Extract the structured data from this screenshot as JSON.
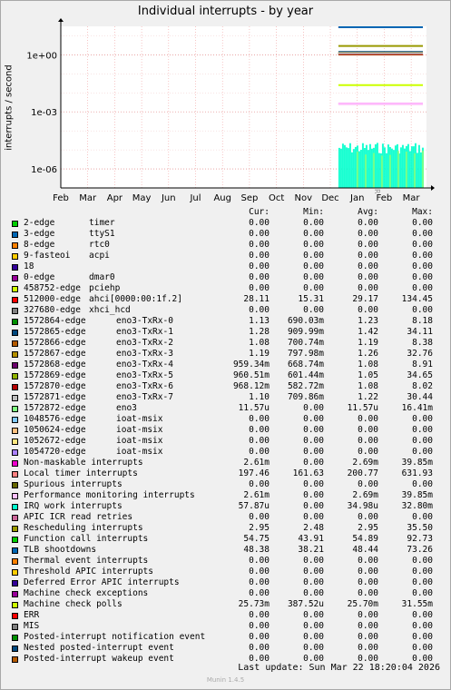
{
  "title": "Individual interrupts - by year",
  "ylabel": "interrupts / second",
  "watermark": "RRDTOOL / TOBI OETIKER",
  "footer": {
    "last_update": "Last update:  Sun Mar 22 18:20:04 2026",
    "version": "Munin 1.4.5"
  },
  "table_headers": {
    "cur": "Cur:",
    "min": "Min:",
    "avg": "Avg:",
    "max": "Max:"
  },
  "chart_data": {
    "type": "line",
    "title": "Individual interrupts - by year",
    "ylabel": "interrupts / second",
    "xlabel": "",
    "y_scale": "log",
    "y_ticks": [
      "1e-06",
      "1e-03",
      "1e+00"
    ],
    "x_ticks": [
      "Feb",
      "Mar",
      "Apr",
      "May",
      "Jun",
      "Jul",
      "Aug",
      "Sep",
      "Oct",
      "Nov",
      "Dec",
      "Jan",
      "Feb",
      "Mar"
    ],
    "grid": true,
    "legend_position": "bottom",
    "series": [
      {
        "name": "2-edge",
        "sub": "timer",
        "color": "#00cc00",
        "cur": "0.00",
        "min": "0.00",
        "avg": "0.00",
        "max": "0.00"
      },
      {
        "name": "3-edge",
        "sub": "ttyS1",
        "color": "#0066b3",
        "cur": "0.00",
        "min": "0.00",
        "avg": "0.00",
        "max": "0.00"
      },
      {
        "name": "8-edge",
        "sub": "rtc0",
        "color": "#ff8000",
        "cur": "0.00",
        "min": "0.00",
        "avg": "0.00",
        "max": "0.00"
      },
      {
        "name": "9-fasteoi",
        "sub": "acpi",
        "color": "#ffcc00",
        "cur": "0.00",
        "min": "0.00",
        "avg": "0.00",
        "max": "0.00"
      },
      {
        "name": "18",
        "sub": "",
        "color": "#330099",
        "cur": "0.00",
        "min": "0.00",
        "avg": "0.00",
        "max": "0.00"
      },
      {
        "name": "0-edge",
        "sub": "dmar0",
        "color": "#990099",
        "cur": "0.00",
        "min": "0.00",
        "avg": "0.00",
        "max": "0.00"
      },
      {
        "name": "458752-edge",
        "sub": "pciehp",
        "color": "#ccff00",
        "cur": "0.00",
        "min": "0.00",
        "avg": "0.00",
        "max": "0.00"
      },
      {
        "name": "512000-edge",
        "sub": "ahci[0000:00:1f.2]",
        "color": "#ff0000",
        "cur": "28.11",
        "min": "15.31",
        "avg": "29.17",
        "max": "134.45"
      },
      {
        "name": "327680-edge",
        "sub": "xhci_hcd",
        "color": "#808080",
        "cur": "0.00",
        "min": "0.00",
        "avg": "0.00",
        "max": "0.00"
      },
      {
        "name": "1572864-edge",
        "sub": "eno3-TxRx-0",
        "color": "#008f00",
        "cur": "1.13",
        "min": "690.03m",
        "avg": "1.23",
        "max": "8.18"
      },
      {
        "name": "1572865-edge",
        "sub": "eno3-TxRx-1",
        "color": "#00487d",
        "cur": "1.28",
        "min": "909.99m",
        "avg": "1.42",
        "max": "34.11"
      },
      {
        "name": "1572866-edge",
        "sub": "eno3-TxRx-2",
        "color": "#b35a00",
        "cur": "1.08",
        "min": "700.74m",
        "avg": "1.19",
        "max": "8.38"
      },
      {
        "name": "1572867-edge",
        "sub": "eno3-TxRx-3",
        "color": "#b38f00",
        "cur": "1.19",
        "min": "797.98m",
        "avg": "1.26",
        "max": "32.76"
      },
      {
        "name": "1572868-edge",
        "sub": "eno3-TxRx-4",
        "color": "#6b006b",
        "cur": "959.34m",
        "min": "668.74m",
        "avg": "1.08",
        "max": "8.91"
      },
      {
        "name": "1572869-edge",
        "sub": "eno3-TxRx-5",
        "color": "#8fb300",
        "cur": "960.51m",
        "min": "601.44m",
        "avg": "1.05",
        "max": "34.65"
      },
      {
        "name": "1572870-edge",
        "sub": "eno3-TxRx-6",
        "color": "#b30000",
        "cur": "968.12m",
        "min": "582.72m",
        "avg": "1.08",
        "max": "8.02"
      },
      {
        "name": "1572871-edge",
        "sub": "eno3-TxRx-7",
        "color": "#bebebe",
        "cur": "1.10",
        "min": "709.86m",
        "avg": "1.22",
        "max": "30.44"
      },
      {
        "name": "1572872-edge",
        "sub": "eno3",
        "color": "#80ff80",
        "cur": "11.57u",
        "min": "0.00",
        "avg": "11.57u",
        "max": "16.41m"
      },
      {
        "name": "1048576-edge",
        "sub": "ioat-msix",
        "color": "#80c9ff",
        "cur": "0.00",
        "min": "0.00",
        "avg": "0.00",
        "max": "0.00"
      },
      {
        "name": "1050624-edge",
        "sub": "ioat-msix",
        "color": "#ffc080",
        "cur": "0.00",
        "min": "0.00",
        "avg": "0.00",
        "max": "0.00"
      },
      {
        "name": "1052672-edge",
        "sub": "ioat-msix",
        "color": "#ffe680",
        "cur": "0.00",
        "min": "0.00",
        "avg": "0.00",
        "max": "0.00"
      },
      {
        "name": "1054720-edge",
        "sub": "ioat-msix",
        "color": "#aa80ff",
        "cur": "0.00",
        "min": "0.00",
        "avg": "0.00",
        "max": "0.00"
      },
      {
        "name": "Non-maskable interrupts",
        "sub": "",
        "color": "#ee00cc",
        "cur": "2.61m",
        "min": "0.00",
        "avg": "2.69m",
        "max": "39.85m"
      },
      {
        "name": "Local timer interrupts",
        "sub": "",
        "color": "#ff8080",
        "cur": "197.46",
        "min": "161.63",
        "avg": "200.77",
        "max": "631.93"
      },
      {
        "name": "Spurious interrupts",
        "sub": "",
        "color": "#666600",
        "cur": "0.00",
        "min": "0.00",
        "avg": "0.00",
        "max": "0.00"
      },
      {
        "name": "Performance monitoring interrupts",
        "sub": "",
        "color": "#ffbfff",
        "cur": "2.61m",
        "min": "0.00",
        "avg": "2.69m",
        "max": "39.85m"
      },
      {
        "name": "IRQ work interrupts",
        "sub": "",
        "color": "#00ffcc",
        "cur": "57.87u",
        "min": "0.00",
        "avg": "34.98u",
        "max": "32.80m"
      },
      {
        "name": "APIC ICR read retries",
        "sub": "",
        "color": "#cc6699",
        "cur": "0.00",
        "min": "0.00",
        "avg": "0.00",
        "max": "0.00"
      },
      {
        "name": "Rescheduling interrupts",
        "sub": "",
        "color": "#999900",
        "cur": "2.95",
        "min": "2.48",
        "avg": "2.95",
        "max": "35.50"
      },
      {
        "name": "Function call interrupts",
        "sub": "",
        "color": "#00cc00",
        "cur": "54.75",
        "min": "43.91",
        "avg": "54.89",
        "max": "92.73"
      },
      {
        "name": "TLB shootdowns",
        "sub": "",
        "color": "#0066b3",
        "cur": "48.38",
        "min": "38.21",
        "avg": "48.44",
        "max": "73.26"
      },
      {
        "name": "Thermal event interrupts",
        "sub": "",
        "color": "#ff8000",
        "cur": "0.00",
        "min": "0.00",
        "avg": "0.00",
        "max": "0.00"
      },
      {
        "name": "Threshold APIC interrupts",
        "sub": "",
        "color": "#ffcc00",
        "cur": "0.00",
        "min": "0.00",
        "avg": "0.00",
        "max": "0.00"
      },
      {
        "name": "Deferred Error APIC interrupts",
        "sub": "",
        "color": "#330099",
        "cur": "0.00",
        "min": "0.00",
        "avg": "0.00",
        "max": "0.00"
      },
      {
        "name": "Machine check exceptions",
        "sub": "",
        "color": "#990099",
        "cur": "0.00",
        "min": "0.00",
        "avg": "0.00",
        "max": "0.00"
      },
      {
        "name": "Machine check polls",
        "sub": "",
        "color": "#ccff00",
        "cur": "25.73m",
        "min": "387.52u",
        "avg": "25.70m",
        "max": "31.55m"
      },
      {
        "name": "ERR",
        "sub": "",
        "color": "#ff0000",
        "cur": "0.00",
        "min": "0.00",
        "avg": "0.00",
        "max": "0.00"
      },
      {
        "name": "MIS",
        "sub": "",
        "color": "#808080",
        "cur": "0.00",
        "min": "0.00",
        "avg": "0.00",
        "max": "0.00"
      },
      {
        "name": "Posted-interrupt notification event",
        "sub": "",
        "color": "#008f00",
        "cur": "0.00",
        "min": "0.00",
        "avg": "0.00",
        "max": "0.00"
      },
      {
        "name": "Nested posted-interrupt event",
        "sub": "",
        "color": "#00487d",
        "cur": "0.00",
        "min": "0.00",
        "avg": "0.00",
        "max": "0.00"
      },
      {
        "name": "Posted-interrupt wakeup event",
        "sub": "",
        "color": "#b35a00",
        "cur": "0.00",
        "min": "0.00",
        "avg": "0.00",
        "max": "0.00"
      }
    ]
  }
}
